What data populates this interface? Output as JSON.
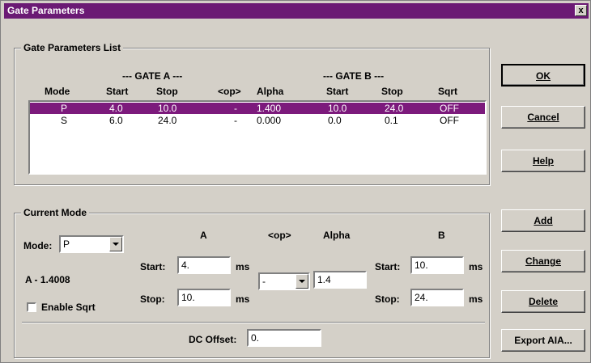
{
  "window": {
    "title": "Gate Parameters",
    "close_glyph": "x"
  },
  "list_group": {
    "title": "Gate Parameters List",
    "gate_a_header": "--- GATE A ---",
    "gate_b_header": "--- GATE B ---",
    "columns": [
      "Mode",
      "Start",
      "Stop",
      "<op>",
      "Alpha",
      "Start",
      "Stop",
      "Sqrt"
    ],
    "rows": [
      [
        "P",
        "4.0",
        "10.0",
        "-",
        "1.400",
        "10.0",
        "24.0",
        "OFF"
      ],
      [
        "S",
        "6.0",
        "24.0",
        "-",
        "0.000",
        "0.0",
        "0.1",
        "OFF"
      ]
    ]
  },
  "current_mode": {
    "title": "Current Mode",
    "mode_label": "Mode:",
    "mode_value": "P",
    "formula": "A - 1.4008",
    "enable_sqrt_label": "Enable Sqrt",
    "col_a": "A",
    "col_op": "<op>",
    "col_alpha": "Alpha",
    "col_b": "B",
    "start_label": "Start:",
    "stop_label": "Stop:",
    "a_start": "4.",
    "a_stop": "10.",
    "op_value": "-",
    "alpha_value": "1.4",
    "b_start": "10.",
    "b_stop": "24.",
    "unit": "ms",
    "dc_offset_label": "DC Offset:",
    "dc_offset_value": "0."
  },
  "buttons": {
    "ok": "OK",
    "cancel": "Cancel",
    "help": "Help",
    "add": "Add",
    "change": "Change",
    "delete": "Delete",
    "export": "Export AIA..."
  },
  "colors": {
    "title_bar": "#6b1a74",
    "selection": "#7c1a7c",
    "face": "#d4d0c8"
  }
}
